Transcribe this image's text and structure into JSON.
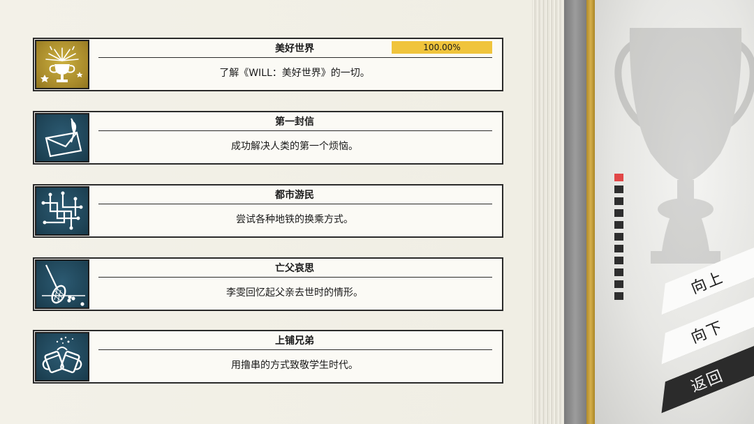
{
  "achievements": [
    {
      "title": "美好世界",
      "description": "了解《WILL：美好世界》的一切。",
      "progress_text": "100.00%",
      "progress": 1.0,
      "icon": "trophy-fireworks-icon",
      "badge_color": "#b69a33"
    },
    {
      "title": "第一封信",
      "description": "成功解决人类的第一个烦恼。",
      "icon": "envelope-quill-icon",
      "badge_color": "#1f4a5e"
    },
    {
      "title": "都市游民",
      "description": "尝试各种地铁的换乘方式。",
      "icon": "subway-map-icon",
      "badge_color": "#1f4a5e"
    },
    {
      "title": "亡父哀思",
      "description": "李雯回忆起父亲去世时的情形。",
      "icon": "tennis-racket-icon",
      "badge_color": "#1f4a5e"
    },
    {
      "title": "上铺兄弟",
      "description": "用撸串的方式致敬学生时代。",
      "icon": "beer-toast-icon",
      "badge_color": "#1f4a5e"
    }
  ],
  "pager": {
    "total_pages": 11,
    "current_page": 1,
    "active_color": "#e14747"
  },
  "nav": {
    "up_label": "向上",
    "down_label": "向下",
    "back_label": "返回"
  }
}
